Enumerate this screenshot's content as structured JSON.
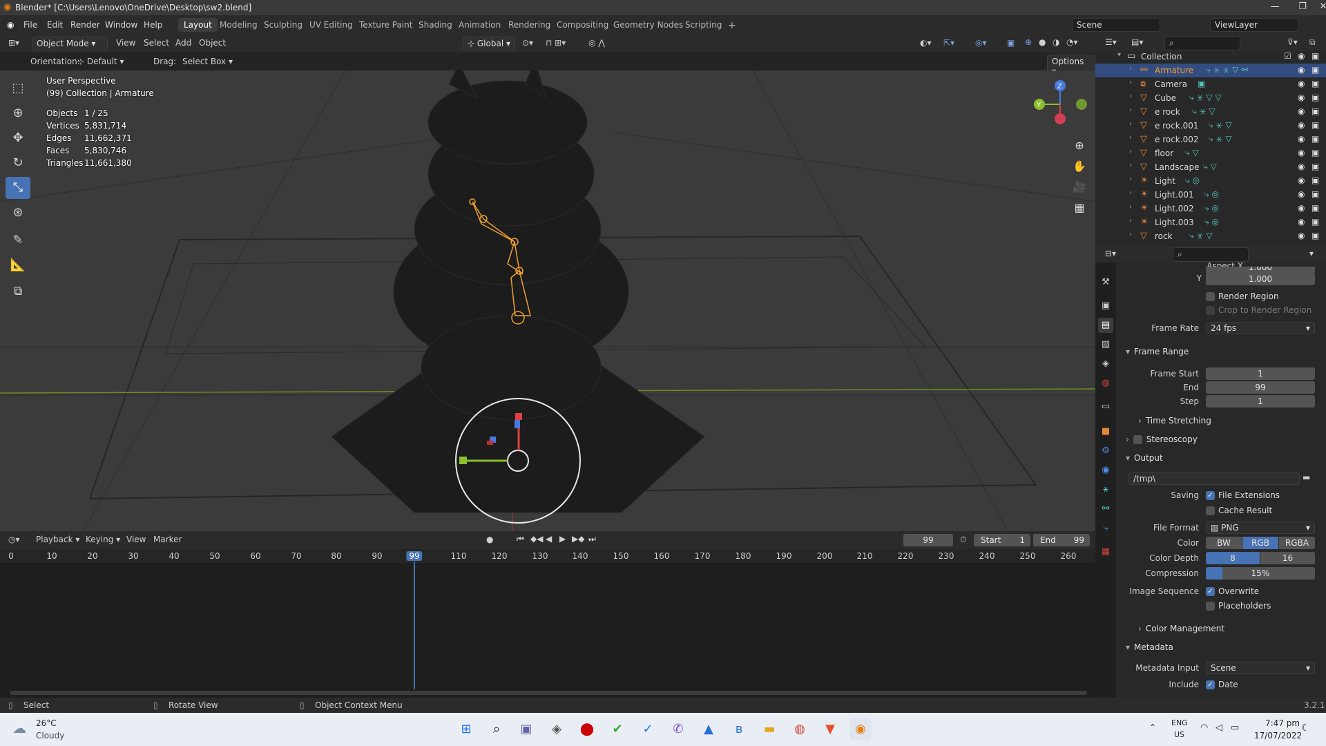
{
  "window": {
    "title": "Blender* [C:\\Users\\Lenovo\\OneDrive\\Desktop\\sw2.blend]"
  },
  "menu": [
    "File",
    "Edit",
    "Render",
    "Window",
    "Help"
  ],
  "workspaces": [
    "Layout",
    "Modeling",
    "Sculpting",
    "UV Editing",
    "Texture Paint",
    "Shading",
    "Animation",
    "Rendering",
    "Compositing",
    "Geometry Nodes",
    "Scripting"
  ],
  "workspace_active": "Layout",
  "scene": {
    "name": "Scene",
    "view_layer": "ViewLayer"
  },
  "viewport_header": {
    "mode": "Object Mode",
    "menus": [
      "View",
      "Select",
      "Add",
      "Object"
    ],
    "transform": "Global",
    "orientation_label": "Orientation:",
    "orientation": "Default",
    "drag_label": "Drag:",
    "drag": "Select Box",
    "options": "Options"
  },
  "viewport": {
    "view_name": "User Perspective",
    "collection": "(99) Collection | Armature",
    "stats": [
      {
        "label": "Objects",
        "value": "1 / 25"
      },
      {
        "label": "Vertices",
        "value": "5,831,714"
      },
      {
        "label": "Edges",
        "value": "11,662,371"
      },
      {
        "label": "Faces",
        "value": "5,830,746"
      },
      {
        "label": "Triangles",
        "value": "11,661,380"
      }
    ],
    "gizmo_axes": [
      "Z",
      "Y"
    ]
  },
  "outliner": {
    "root": "Collection",
    "items": [
      {
        "name": "Armature",
        "type": "armature",
        "selected": true
      },
      {
        "name": "Camera",
        "type": "camera",
        "selected": false
      },
      {
        "name": "Cube",
        "type": "mesh",
        "selected": false
      },
      {
        "name": "e rock",
        "type": "mesh",
        "selected": false
      },
      {
        "name": "e rock.001",
        "type": "mesh",
        "selected": false
      },
      {
        "name": "e rock.002",
        "type": "mesh",
        "selected": false
      },
      {
        "name": "floor",
        "type": "mesh",
        "selected": false
      },
      {
        "name": "Landscape",
        "type": "mesh",
        "selected": false
      },
      {
        "name": "Light",
        "type": "light",
        "selected": false
      },
      {
        "name": "Light.001",
        "type": "light",
        "selected": false
      },
      {
        "name": "Light.002",
        "type": "light",
        "selected": false
      },
      {
        "name": "Light.003",
        "type": "light",
        "selected": false
      },
      {
        "name": "rock",
        "type": "mesh",
        "selected": false
      }
    ]
  },
  "properties": {
    "aspect_x_label": "Aspect X",
    "aspect_x": "1.000",
    "aspect_y_label": "Y",
    "aspect_y": "1.000",
    "render_region": "Render Region",
    "crop_region": "Crop to Render Region",
    "frame_rate_label": "Frame Rate",
    "frame_rate": "24 fps",
    "frame_range_title": "Frame Range",
    "frame_start_label": "Frame Start",
    "frame_start": "1",
    "end_label": "End",
    "end": "99",
    "step_label": "Step",
    "step": "1",
    "time_stretching": "Time Stretching",
    "stereoscopy": "Stereoscopy",
    "output_title": "Output",
    "output_path": "/tmp\\",
    "saving_label": "Saving",
    "file_extensions": "File Extensions",
    "cache_result": "Cache Result",
    "file_format_label": "File Format",
    "file_format": "PNG",
    "color_label": "Color",
    "color_options": [
      "BW",
      "RGB",
      "RGBA"
    ],
    "color_selected": "RGB",
    "color_depth_label": "Color Depth",
    "color_depth_options": [
      "8",
      "16"
    ],
    "color_depth_selected": "8",
    "compression_label": "Compression",
    "compression": "15%",
    "compression_fraction": 0.15,
    "image_sequence_label": "Image Sequence",
    "overwrite": "Overwrite",
    "placeholders": "Placeholders",
    "color_management": "Color Management",
    "metadata_title": "Metadata",
    "metadata_input_label": "Metadata Input",
    "metadata_input": "Scene",
    "include_label": "Include",
    "include_date": "Date"
  },
  "timeline": {
    "menus": [
      "Playback",
      "Keying",
      "View",
      "Marker"
    ],
    "current_frame": "99",
    "start_label": "Start",
    "start": "1",
    "end_label": "End",
    "end": "99",
    "ticks": [
      "0",
      "10",
      "20",
      "30",
      "40",
      "50",
      "60",
      "70",
      "80",
      "90",
      "99",
      "110",
      "120",
      "130",
      "140",
      "150",
      "160",
      "170",
      "180",
      "190",
      "200",
      "210",
      "220",
      "230",
      "240",
      "250",
      "260"
    ]
  },
  "statusbar": {
    "items": [
      "Select",
      "Rotate View",
      "Object Context Menu"
    ],
    "version": "3.2.1"
  },
  "taskbar": {
    "weather_temp": "26°C",
    "weather_desc": "Cloudy",
    "lang": "ENG",
    "region": "US",
    "time": "7:47 pm",
    "date": "17/07/2022"
  },
  "colors": {
    "accent": "#4772b3",
    "selection_orange": "#f0a030",
    "grid_green": "#6c8f22"
  }
}
